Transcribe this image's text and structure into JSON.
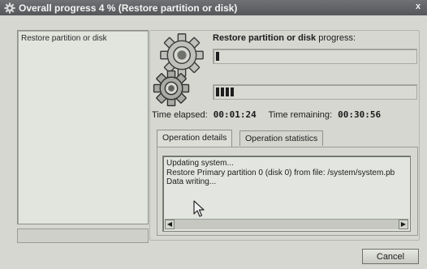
{
  "window": {
    "title": "Overall progress 4 % (Restore partition or disk)",
    "close_glyph": "x"
  },
  "left_panel": {
    "items": [
      "Restore partition or disk"
    ]
  },
  "operation": {
    "name": "Restore partition or disk",
    "suffix": "progress:",
    "progress_top_fraction": 0.02,
    "progress_bottom_fraction": 0.1
  },
  "timing": {
    "elapsed_label": "Time elapsed:",
    "elapsed_value": "00:01:24",
    "remaining_label": "Time remaining:",
    "remaining_value": "00:30:56"
  },
  "tabs": [
    {
      "label": "Operation details",
      "active": true
    },
    {
      "label": "Operation statistics",
      "active": false
    }
  ],
  "log": {
    "lines": [
      "Updating system...",
      "Restore Primary partition 0 (disk 0) from file: /system/system.pb",
      "Data writing..."
    ]
  },
  "buttons": {
    "cancel": "Cancel"
  },
  "icons": {
    "title": "gear-icon",
    "operation_big": "gear-icon",
    "operation_small": "gear-icon"
  }
}
